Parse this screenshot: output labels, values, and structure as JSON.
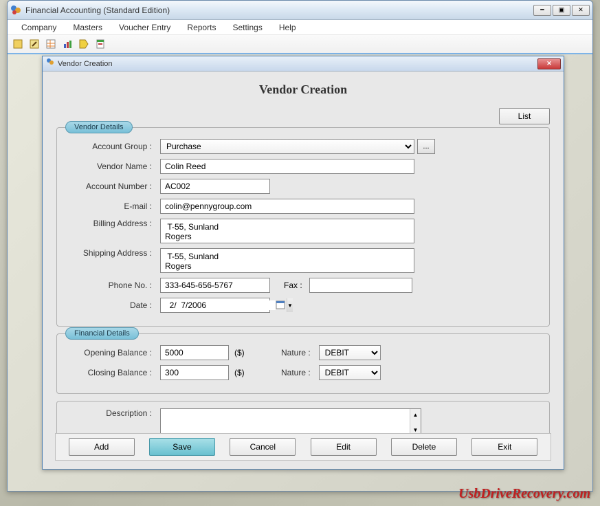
{
  "app": {
    "title": "Financial Accounting (Standard Edition)"
  },
  "menu": {
    "items": [
      "Company",
      "Masters",
      "Voucher Entry",
      "Reports",
      "Settings",
      "Help"
    ]
  },
  "dialog": {
    "windowTitle": "Vendor Creation",
    "heading": "Vendor Creation",
    "listButton": "List"
  },
  "vendorDetails": {
    "legend": "Vendor Details",
    "labels": {
      "accountGroup": "Account Group :",
      "vendorName": "Vendor Name :",
      "accountNumber": "Account Number :",
      "email": "E-mail :",
      "billingAddress": "Billing Address :",
      "shippingAddress": "Shipping Address :",
      "phone": "Phone No. :",
      "fax": "Fax :",
      "date": "Date :"
    },
    "values": {
      "accountGroup": "Purchase",
      "vendorName": "Colin Reed",
      "accountNumber": "AC002",
      "email": "colin@pennygroup.com",
      "billingAddress": " T-55, Sunland\nRogers",
      "shippingAddress": " T-55, Sunland\nRogers",
      "phone": "333-645-656-5767",
      "fax": "",
      "date": "  2/  7/2006"
    }
  },
  "financialDetails": {
    "legend": "Financial Details",
    "labels": {
      "openingBalance": "Opening Balance :",
      "closingBalance": "Closing Balance :",
      "nature": "Nature :",
      "currency": "($)"
    },
    "values": {
      "openingBalance": "5000",
      "closingBalance": "300",
      "openingNature": "DEBIT",
      "closingNature": "DEBIT"
    }
  },
  "description": {
    "label": "Description :",
    "value": ""
  },
  "buttons": {
    "add": "Add",
    "save": "Save",
    "cancel": "Cancel",
    "edit": "Edit",
    "delete": "Delete",
    "exit": "Exit"
  },
  "watermark": "UsbDriveRecovery.com"
}
